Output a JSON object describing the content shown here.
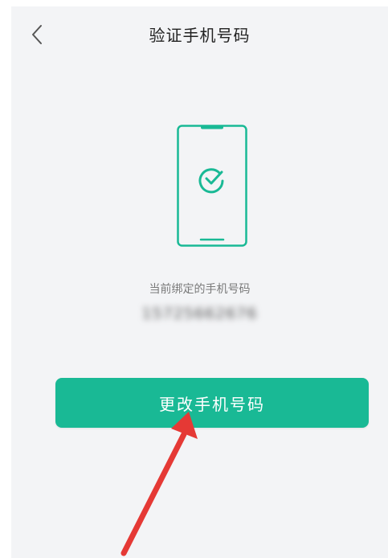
{
  "header": {
    "back_icon": "chevron-left-icon",
    "title": "验证手机号码"
  },
  "illustration": {
    "icon": "phone-check-icon",
    "accent_color": "#19b995"
  },
  "binding": {
    "label": "当前绑定的手机号码",
    "phone_number": "15725662676"
  },
  "actions": {
    "change_phone_label": "更改手机号码",
    "button_color": "#19b995"
  },
  "annotation": {
    "icon": "red-arrow-icon",
    "color": "#e53935"
  }
}
